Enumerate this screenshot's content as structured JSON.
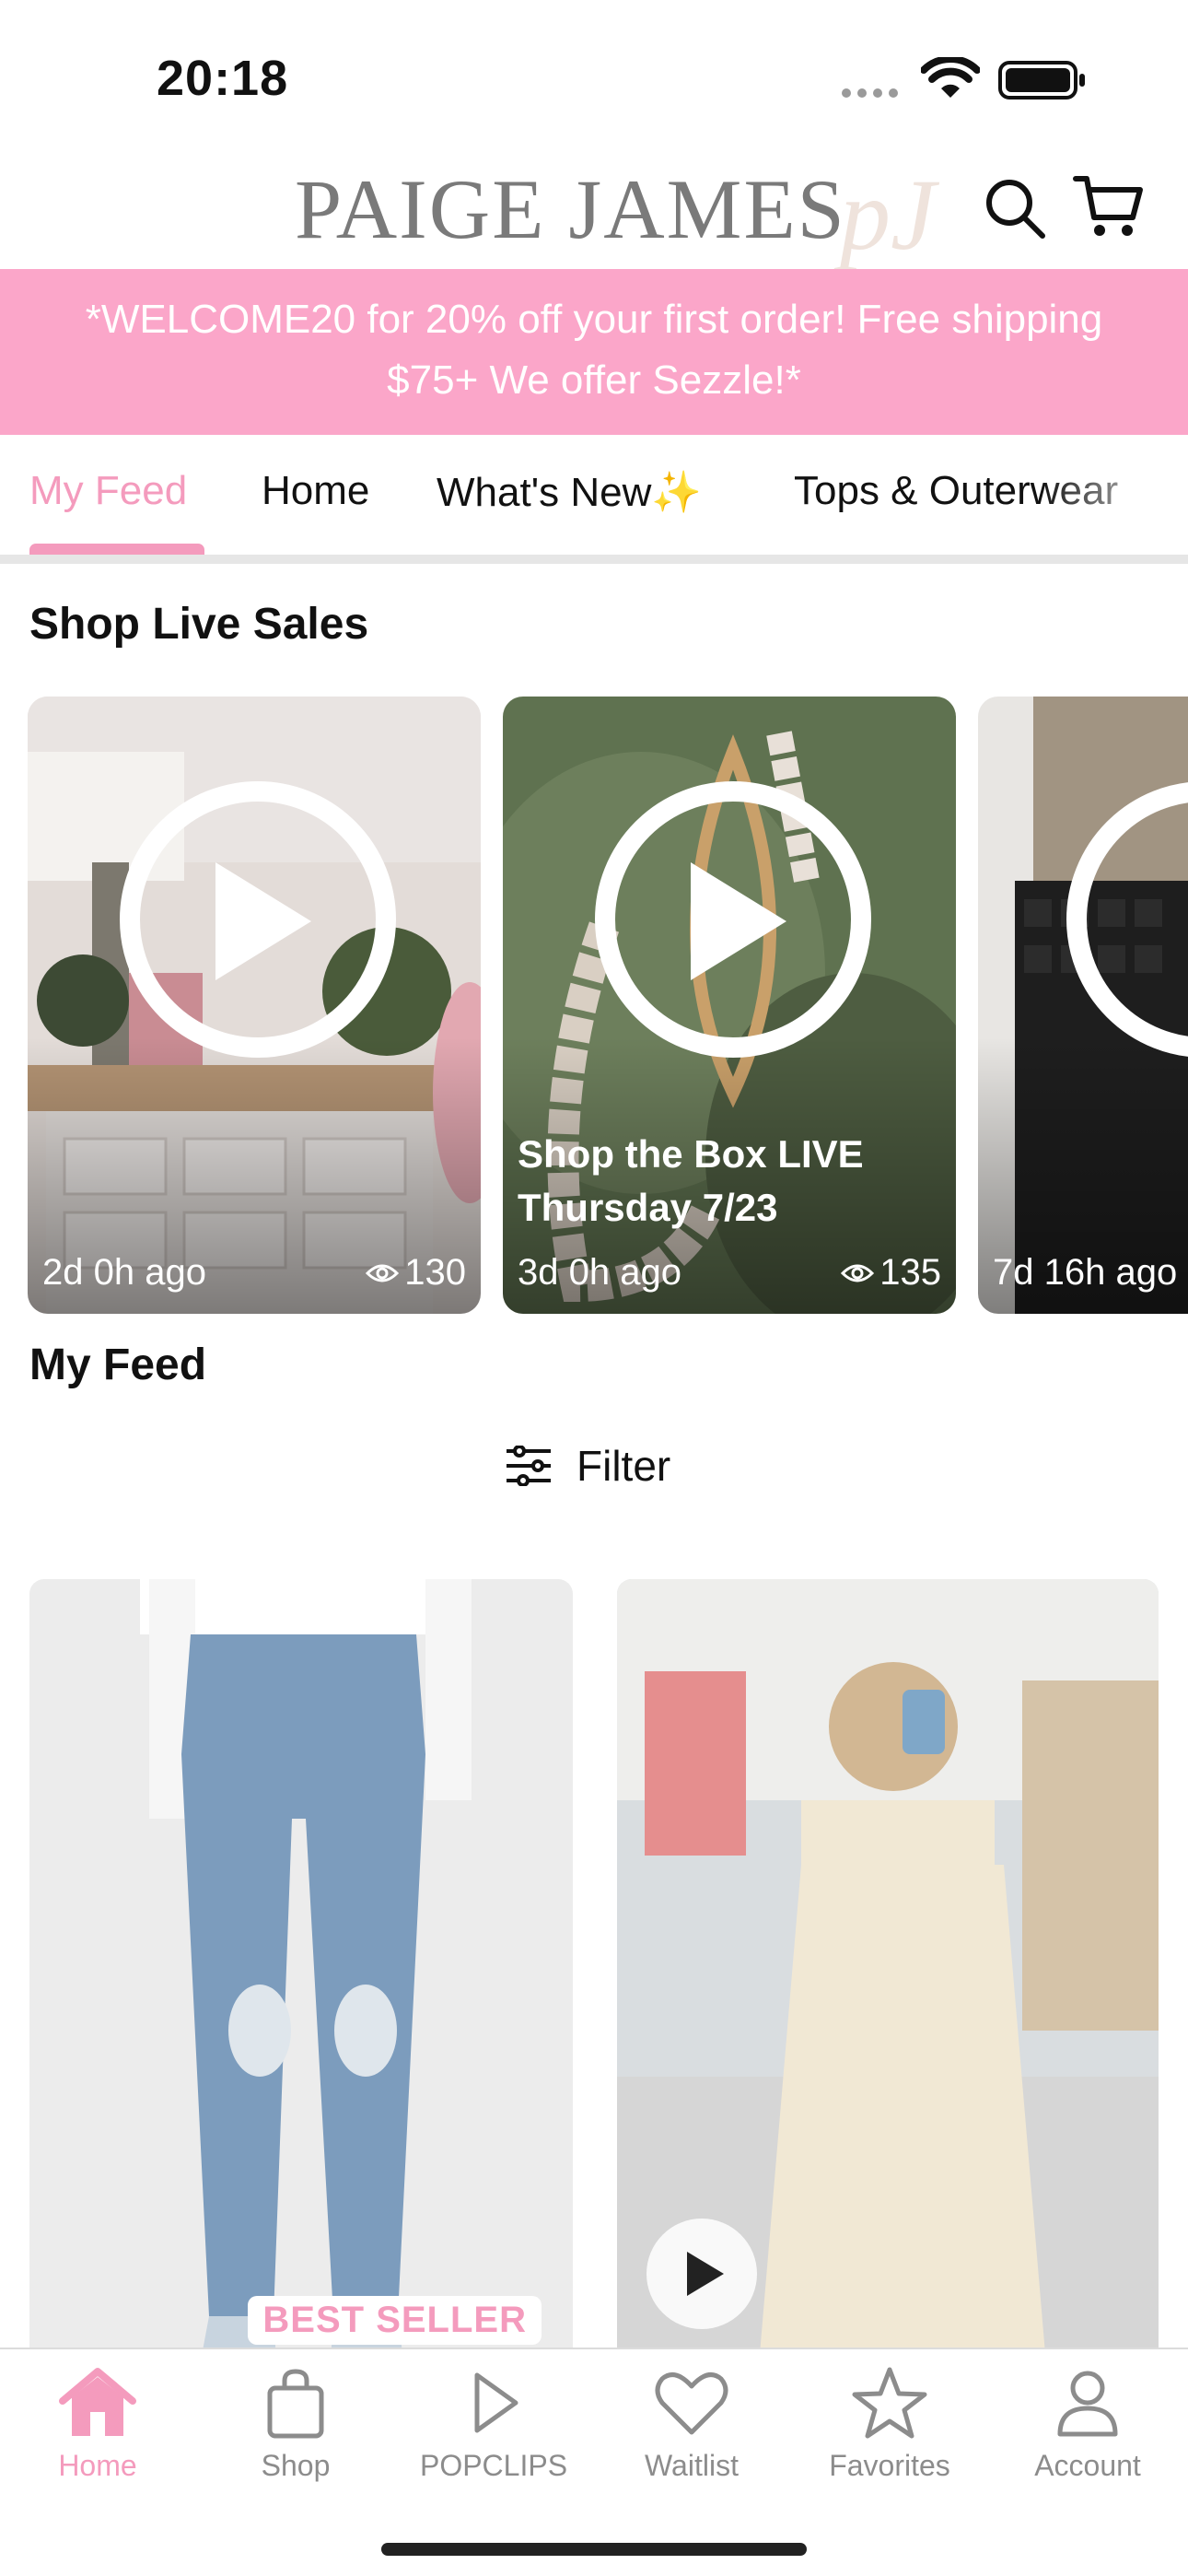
{
  "status_bar": {
    "time": "20:18"
  },
  "header": {
    "brand": "PAIGE JAMES",
    "brand_mark": "pJ"
  },
  "promo": {
    "line1": "*WELCOME20 for 20% off your first order! Free shipping",
    "line2": "$75+ We offer Sezzle!*"
  },
  "tabs": [
    {
      "label": "My Feed",
      "active": true
    },
    {
      "label": "Home"
    },
    {
      "label": "What's New✨"
    },
    {
      "label": "Tops & Outerwear"
    }
  ],
  "live_sales": {
    "title": "Shop Live Sales",
    "items": [
      {
        "title": "",
        "ago": "2d 0h ago",
        "views": "130"
      },
      {
        "title": "Shop the Box LIVE Thursday 7/23",
        "ago": "3d 0h ago",
        "views": "135"
      },
      {
        "title": "",
        "ago": "7d 16h ago",
        "views": ""
      }
    ]
  },
  "feed": {
    "title": "My Feed",
    "filter_label": "Filter",
    "items": [
      {
        "badge": "BEST SELLER"
      },
      {
        "badge": ""
      }
    ]
  },
  "bottom_nav": [
    {
      "label": "Home",
      "icon": "home-icon",
      "active": true
    },
    {
      "label": "Shop",
      "icon": "bag-icon"
    },
    {
      "label": "POPCLIPS",
      "icon": "play-icon"
    },
    {
      "label": "Waitlist",
      "icon": "heart-icon"
    },
    {
      "label": "Favorites",
      "icon": "star-icon"
    },
    {
      "label": "Account",
      "icon": "person-icon"
    }
  ],
  "colors": {
    "accent": "#f49bbd",
    "promo_bg": "#fba6c9"
  }
}
